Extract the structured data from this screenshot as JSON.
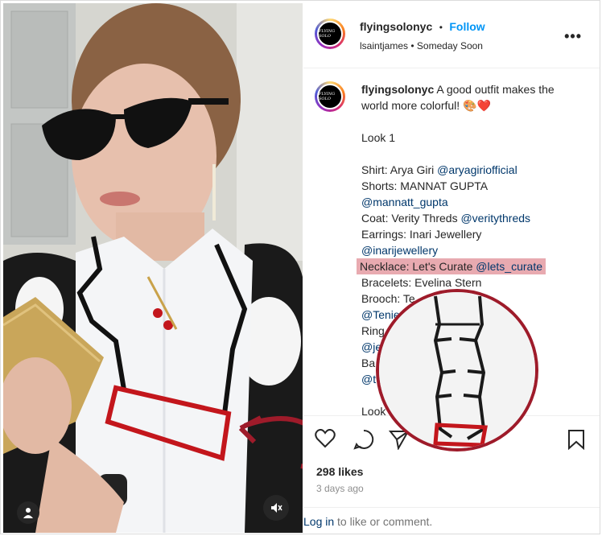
{
  "header": {
    "username": "flyingsolonyc",
    "dot": "•",
    "follow_label": "Follow",
    "music_artist": "lsaintjames",
    "music_title": "Someday Soon",
    "more_icon": "more-icon"
  },
  "avatar_text": "FLYING SOLO",
  "caption": {
    "username": "flyingsolonyc",
    "text_1": "A good outfit makes the",
    "text_2": "world more colorful! 🎨❤️",
    "look1": "Look 1",
    "shirt": "Shirt: Arya Giri ",
    "shirt_mention": "@aryagiriofficial",
    "shorts": "Shorts: MANNAT GUPTA",
    "shorts_mention": "@mannatt_gupta",
    "coat": "Coat: Verity Threds ",
    "coat_mention": "@veritythreds",
    "earrings": "Earrings: Inari Jewellery",
    "earrings_mention": "@inarijewellery",
    "necklace": "Necklace: Let's Curate ",
    "necklace_mention": "@lets_curate",
    "bracelets": "Bracelets: Evelina Stern",
    "brooch": "Brooch: Te",
    "brooch_mention": "@Tenie",
    "ring": "Ring",
    "ring_mention": "@je",
    "bag": "Ba",
    "bag_mention": "@t",
    "look2": "Look"
  },
  "likes": "298 likes",
  "date": "3 days ago",
  "login": {
    "link": "Log in",
    "rest": " to like or comment."
  },
  "colors": {
    "accent": "#0095f6",
    "highlight": "#e8aab0",
    "annotation": "#9e1b2a"
  }
}
